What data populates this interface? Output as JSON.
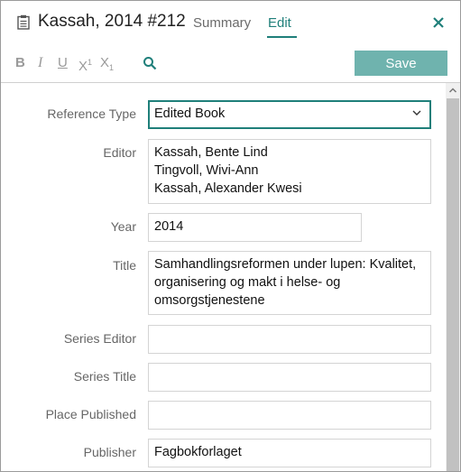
{
  "header": {
    "reference_title": "Kassah, 2014 #212",
    "tabs": [
      {
        "label": "Summary",
        "active": false
      },
      {
        "label": "Edit",
        "active": true
      }
    ],
    "accent_color": "#1f7f7a"
  },
  "toolbar": {
    "bold": "B",
    "italic": "I",
    "underline": "U",
    "superscript_base": "X",
    "superscript_mark": "1",
    "subscript_base": "X",
    "subscript_mark": "1",
    "search_icon": "search-icon",
    "save_label": "Save",
    "save_color": "#6fb3ae"
  },
  "form": {
    "reference_type": {
      "label": "Reference Type",
      "value": "Edited Book"
    },
    "editor": {
      "label": "Editor",
      "lines": [
        "Kassah, Bente Lind",
        "Tingvoll, Wivi-Ann",
        "Kassah, Alexander Kwesi"
      ]
    },
    "year": {
      "label": "Year",
      "value": "2014"
    },
    "title": {
      "label": "Title",
      "lines": [
        "Samhandlingsreformen under lupen: Kvalitet,",
        "organisering og makt i helse- og",
        "omsorgstjenestene"
      ]
    },
    "series_editor": {
      "label": "Series Editor",
      "value": ""
    },
    "series_title": {
      "label": "Series Title",
      "value": ""
    },
    "place_published": {
      "label": "Place Published",
      "value": ""
    },
    "publisher": {
      "label": "Publisher",
      "value": "Fagbokforlaget"
    }
  }
}
